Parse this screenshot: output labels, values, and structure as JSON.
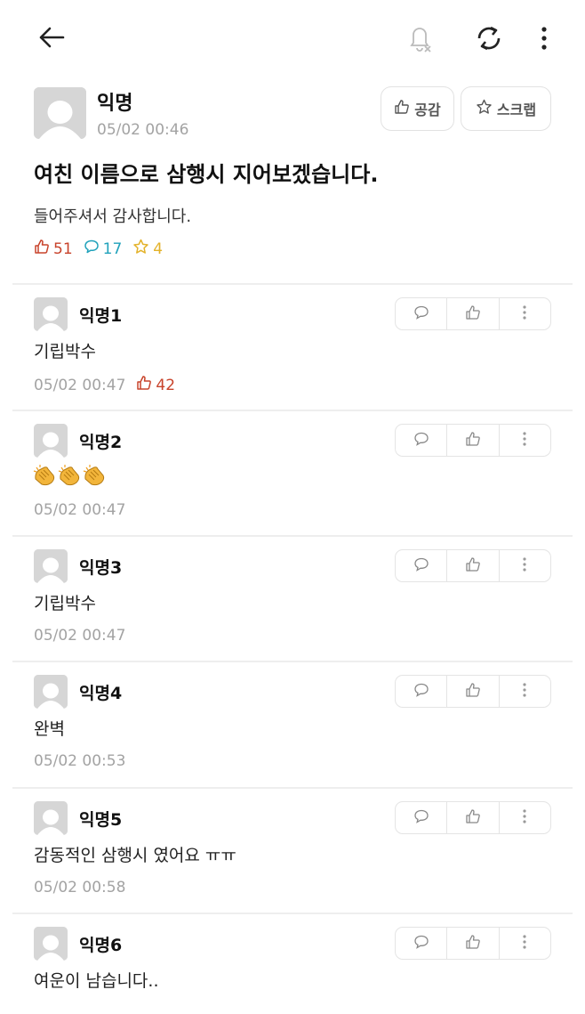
{
  "colors": {
    "like": "#c8432b",
    "comment": "#21a2bb",
    "scrap": "#e3b22a",
    "muted": "#a3a3a3"
  },
  "topbar": {
    "icons": [
      "back-arrow-icon",
      "notification-off-icon",
      "refresh-icon",
      "more-vertical-icon"
    ]
  },
  "post": {
    "author": "익명",
    "time": "05/02 00:46",
    "like_label": "공감",
    "scrap_label": "스크랩",
    "title": "여친 이름으로 삼행시 지어보겠습니다.",
    "body": "들어주셔서 감사합니다.",
    "like_count": "51",
    "comment_count": "17",
    "scrap_count": "4"
  },
  "comments": [
    {
      "author": "익명1",
      "text": "기립박수",
      "time": "05/02 00:47",
      "likes": "42"
    },
    {
      "author": "익명2",
      "text": "",
      "emoji": "clapping-hands x3",
      "time": "05/02 00:47",
      "likes": ""
    },
    {
      "author": "익명3",
      "text": "기립박수",
      "time": "05/02 00:47",
      "likes": ""
    },
    {
      "author": "익명4",
      "text": "완벽",
      "time": "05/02 00:53",
      "likes": ""
    },
    {
      "author": "익명5",
      "text": "감동적인 삼행시 였어요 ㅠㅠ",
      "time": "05/02 00:58",
      "likes": ""
    },
    {
      "author": "익명6",
      "text": "여운이 남습니다..",
      "time": "",
      "likes": ""
    }
  ]
}
